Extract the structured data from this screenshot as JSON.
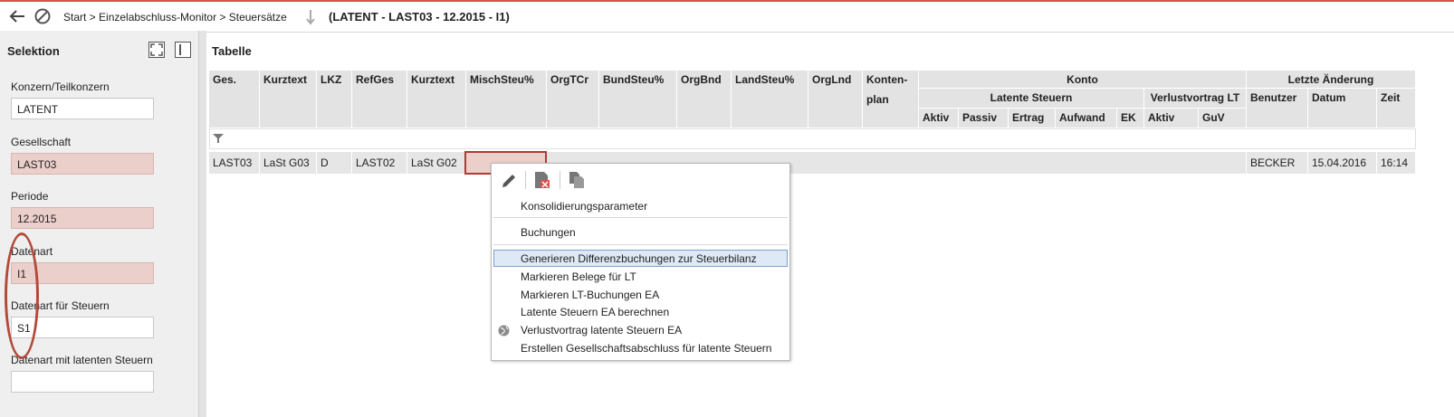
{
  "topbar": {
    "breadcrumb": "Start > Einzelabschluss-Monitor > Steuersätze",
    "title": "(LATENT - LAST03 - 12.2015 - I1)"
  },
  "selection": {
    "header": "Selektion",
    "fields": [
      {
        "label": "Konzern/Teilkonzern",
        "value": "LATENT",
        "locked": false
      },
      {
        "label": "Gesellschaft",
        "value": "LAST03",
        "locked": true
      },
      {
        "label": "Periode",
        "value": "12.2015",
        "locked": true
      },
      {
        "label": "Datenart",
        "value": "I1",
        "locked": true
      },
      {
        "label": "Datenart für Steuern",
        "value": "S1",
        "locked": false
      },
      {
        "label": "Datenart mit latenten Steuern",
        "value": "",
        "locked": false
      }
    ]
  },
  "table": {
    "title": "Tabelle",
    "columns": [
      "Ges.",
      "Kurztext",
      "LKZ",
      "RefGes",
      "Kurztext",
      "MischSteu%",
      "OrgTCr",
      "BundSteu%",
      "OrgBnd",
      "LandSteu%",
      "OrgLnd",
      "Konten-",
      "plan"
    ],
    "group_konto": "Konto",
    "group_latente": "Latente Steuern",
    "group_verlust": "Verlustvortrag LT",
    "group_letzte": "Letzte Änderung",
    "sub_latente": [
      "Aktiv",
      "Passiv",
      "Ertrag",
      "Aufwand",
      "EK"
    ],
    "sub_verlust": [
      "Aktiv",
      "GuV"
    ],
    "sub_letzte": [
      "Benutzer",
      "Datum",
      "Zeit"
    ],
    "row": {
      "ges": "LAST03",
      "kurztext": "LaSt G03",
      "lkz": "D",
      "refges": "LAST02",
      "kurztext2": "LaSt G02",
      "benutzer": "BECKER",
      "datum": "15.04.2016",
      "zeit": "16:14"
    }
  },
  "context_menu": {
    "items": [
      "Konsolidierungsparameter",
      "Buchungen",
      "Generieren Differenzbuchungen zur Steuerbilanz",
      "Markieren Belege für LT",
      "Markieren LT-Buchungen  EA",
      "Latente Steuern EA berechnen",
      "Verlustvortrag latente Steuern EA",
      "Erstellen Gesellschaftsabschluss für latente Steuern"
    ]
  }
}
